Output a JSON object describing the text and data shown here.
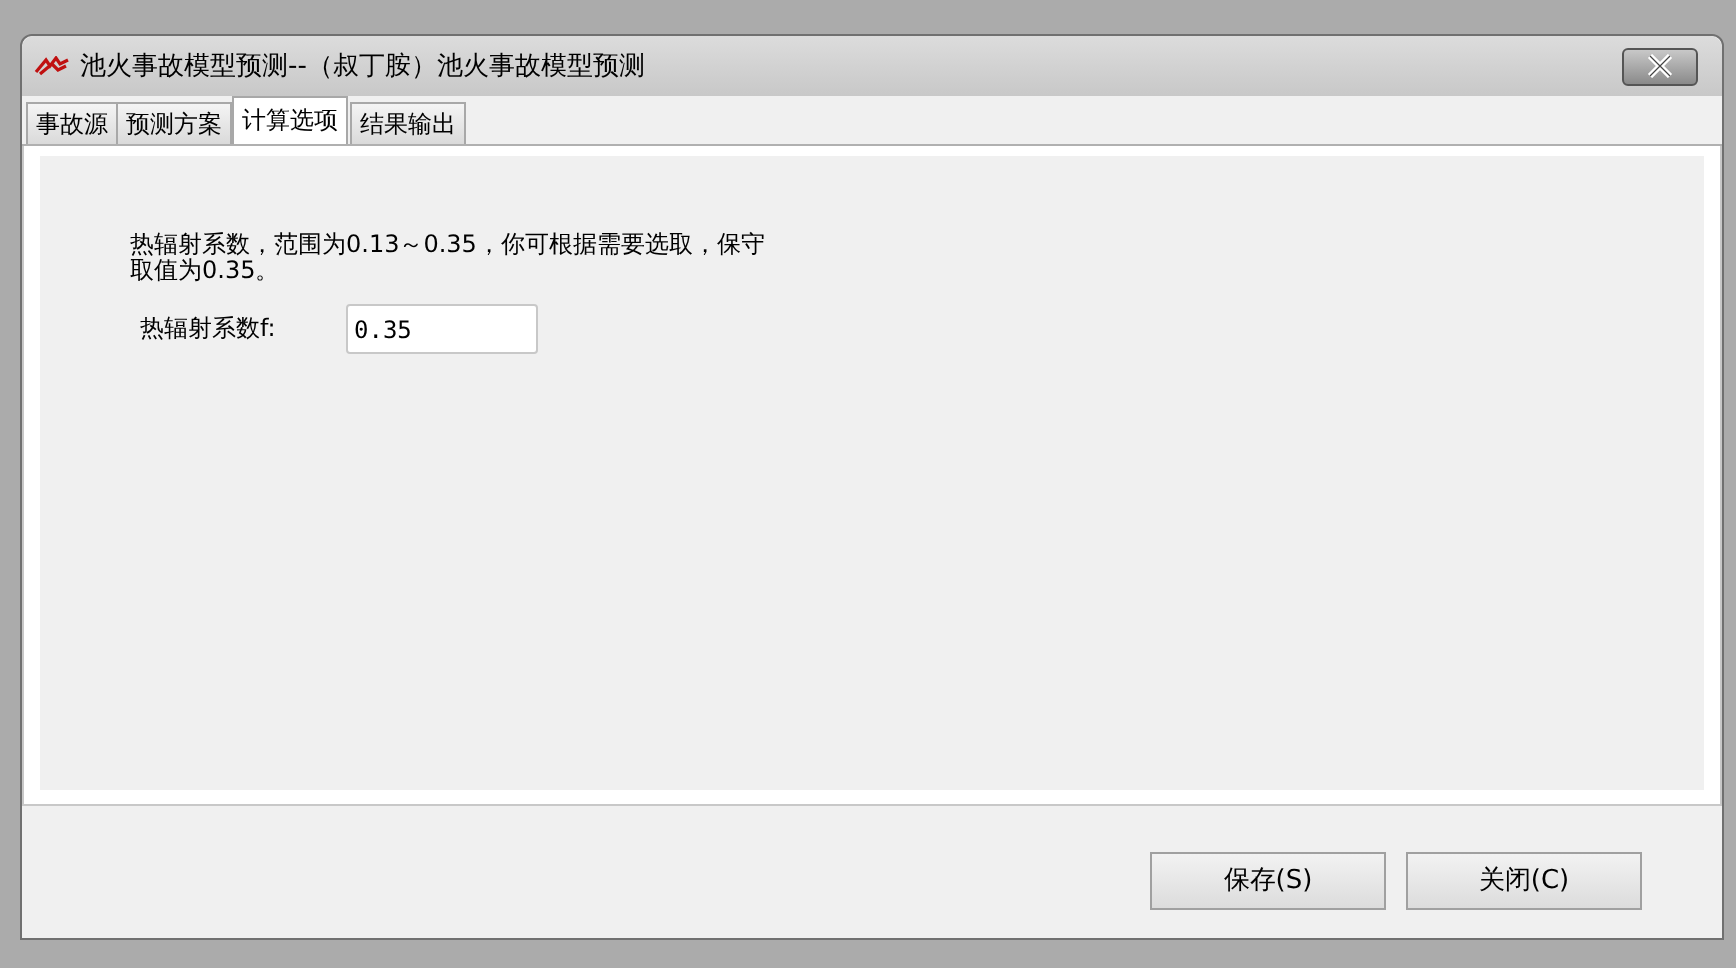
{
  "window": {
    "title": "池火事故模型预测--（叔丁胺）池火事故模型预测"
  },
  "tabs": [
    {
      "label": "事故源",
      "selected": false
    },
    {
      "label": "预测方案",
      "selected": false
    },
    {
      "label": "计算选项",
      "selected": true
    },
    {
      "label": "结果输出",
      "selected": false
    }
  ],
  "description": "热辐射系数，范围为0.13～0.35，你可根据需要选取，保守取值为0.35。",
  "field": {
    "label": "热辐射系数f:",
    "value": "0.35"
  },
  "buttons": [
    "保存(S)",
    "关闭(C)"
  ]
}
